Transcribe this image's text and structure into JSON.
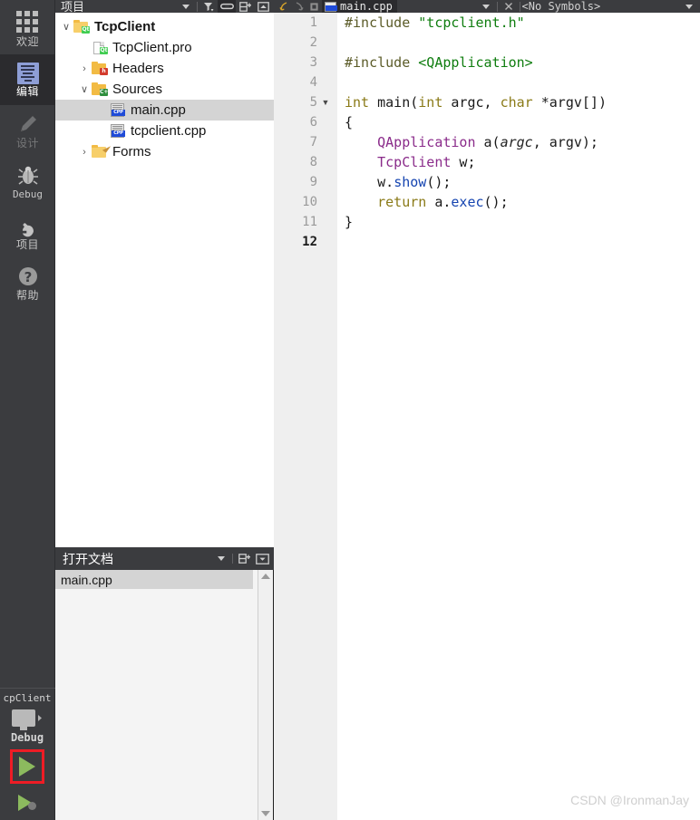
{
  "modebar": {
    "items": [
      {
        "label": "欢迎",
        "icon": "grid-icon",
        "state": "normal"
      },
      {
        "label": "编辑",
        "icon": "edit-icon",
        "state": "selected"
      },
      {
        "label": "设计",
        "icon": "pencil-icon",
        "state": "disabled"
      },
      {
        "label": "Debug",
        "icon": "bug-icon",
        "state": "normal"
      },
      {
        "label": "项目",
        "icon": "wrench-icon",
        "state": "normal"
      },
      {
        "label": "帮助",
        "icon": "question-icon",
        "state": "normal"
      }
    ],
    "kit": {
      "project_name": "cpClient",
      "build_config": "Debug",
      "monitor_icon": "desktop-kit-icon",
      "run_icon": "run-triangle-icon",
      "debug_icon": "debug-run-icon"
    }
  },
  "project_panel": {
    "title": "项目",
    "header_icons": [
      "chevron-down-icon",
      "filter-icon",
      "sync-link-icon",
      "split-icon",
      "collapse-icon"
    ],
    "tree": [
      {
        "level": 0,
        "twisty": "expanded",
        "icon": "qt-project-folder-icon",
        "label": "TcpClient",
        "bold": true,
        "selected": false
      },
      {
        "level": 1,
        "twisty": "none",
        "icon": "qt-pro-file-icon",
        "label": "TcpClient.pro",
        "bold": false,
        "selected": false
      },
      {
        "level": 1,
        "twisty": "collapsed",
        "icon": "headers-folder-icon",
        "label": "Headers",
        "bold": false,
        "selected": false
      },
      {
        "level": 1,
        "twisty": "expanded",
        "icon": "sources-folder-icon",
        "label": "Sources",
        "bold": false,
        "selected": false
      },
      {
        "level": 2,
        "twisty": "none",
        "icon": "cpp-file-icon",
        "label": "main.cpp",
        "bold": false,
        "selected": true
      },
      {
        "level": 2,
        "twisty": "none",
        "icon": "cpp-file-icon",
        "label": "tcpclient.cpp",
        "bold": false,
        "selected": false
      },
      {
        "level": 1,
        "twisty": "collapsed",
        "icon": "forms-folder-icon",
        "label": "Forms",
        "bold": false,
        "selected": false
      }
    ]
  },
  "open_documents": {
    "title": "打开文档",
    "header_icons": [
      "chevron-down-icon",
      "split-icon",
      "close-panel-icon"
    ],
    "items": [
      {
        "label": "main.cpp",
        "selected": true
      }
    ]
  },
  "editor": {
    "nav_icons": [
      "back-arrow-icon",
      "forward-arrow-icon",
      "bookmark-icon"
    ],
    "tab": {
      "label": "main.cpp",
      "file_icon": "cpp-file-icon",
      "dropdown_icon": "chevron-down-icon",
      "close_icon": "close-icon"
    },
    "symbols_selector": "<No Symbols>",
    "symbols_dropdown_icon": "chevron-down-icon",
    "lines": [
      {
        "num": "1",
        "fold": "",
        "current": false,
        "tokens": [
          {
            "t": "#include ",
            "c": "t-pre"
          },
          {
            "t": "\"tcpclient.h\"",
            "c": "t-str"
          }
        ]
      },
      {
        "num": "2",
        "fold": "",
        "current": false,
        "tokens": []
      },
      {
        "num": "3",
        "fold": "",
        "current": false,
        "tokens": [
          {
            "t": "#include ",
            "c": "t-pre"
          },
          {
            "t": "<QApplication>",
            "c": "t-str"
          }
        ]
      },
      {
        "num": "4",
        "fold": "",
        "current": false,
        "tokens": []
      },
      {
        "num": "5",
        "fold": "▼",
        "current": false,
        "tokens": [
          {
            "t": "int ",
            "c": "t-kw"
          },
          {
            "t": "main(",
            "c": "t-plain"
          },
          {
            "t": "int ",
            "c": "t-kw"
          },
          {
            "t": "argc",
            "c": "t-plain"
          },
          {
            "t": ", ",
            "c": "t-plain"
          },
          {
            "t": "char ",
            "c": "t-kw"
          },
          {
            "t": "*argv[])",
            "c": "t-plain"
          }
        ]
      },
      {
        "num": "6",
        "fold": "",
        "current": false,
        "tokens": [
          {
            "t": "{",
            "c": "t-plain"
          }
        ]
      },
      {
        "num": "7",
        "fold": "",
        "current": false,
        "tokens": [
          {
            "t": "    ",
            "c": "t-plain"
          },
          {
            "t": "QApplication",
            "c": "t-type"
          },
          {
            "t": " a(",
            "c": "t-plain"
          },
          {
            "t": "argc",
            "c": "t-param"
          },
          {
            "t": ", argv);",
            "c": "t-plain"
          }
        ]
      },
      {
        "num": "8",
        "fold": "",
        "current": false,
        "tokens": [
          {
            "t": "    ",
            "c": "t-plain"
          },
          {
            "t": "TcpClient",
            "c": "t-type"
          },
          {
            "t": " w;",
            "c": "t-plain"
          }
        ]
      },
      {
        "num": "9",
        "fold": "",
        "current": false,
        "tokens": [
          {
            "t": "    w.",
            "c": "t-plain"
          },
          {
            "t": "show",
            "c": "t-fn"
          },
          {
            "t": "();",
            "c": "t-plain"
          }
        ]
      },
      {
        "num": "10",
        "fold": "",
        "current": false,
        "tokens": [
          {
            "t": "    ",
            "c": "t-plain"
          },
          {
            "t": "return",
            "c": "t-kw"
          },
          {
            "t": " a.",
            "c": "t-plain"
          },
          {
            "t": "exec",
            "c": "t-fn"
          },
          {
            "t": "();",
            "c": "t-plain"
          }
        ]
      },
      {
        "num": "11",
        "fold": "",
        "current": false,
        "tokens": [
          {
            "t": "}",
            "c": "t-plain"
          }
        ]
      },
      {
        "num": "12",
        "fold": "",
        "current": true,
        "tokens": []
      }
    ]
  },
  "watermark": "CSDN @IronmanJay",
  "colors": {
    "chrome_dark": "#3b3c3f",
    "chrome_selected": "#2b2b2e",
    "selection_gray": "#d4d4d4",
    "accent_red_box": "#ee1c25",
    "run_green": "#8cba5e",
    "edit_icon_blue": "#8e9ed6"
  }
}
